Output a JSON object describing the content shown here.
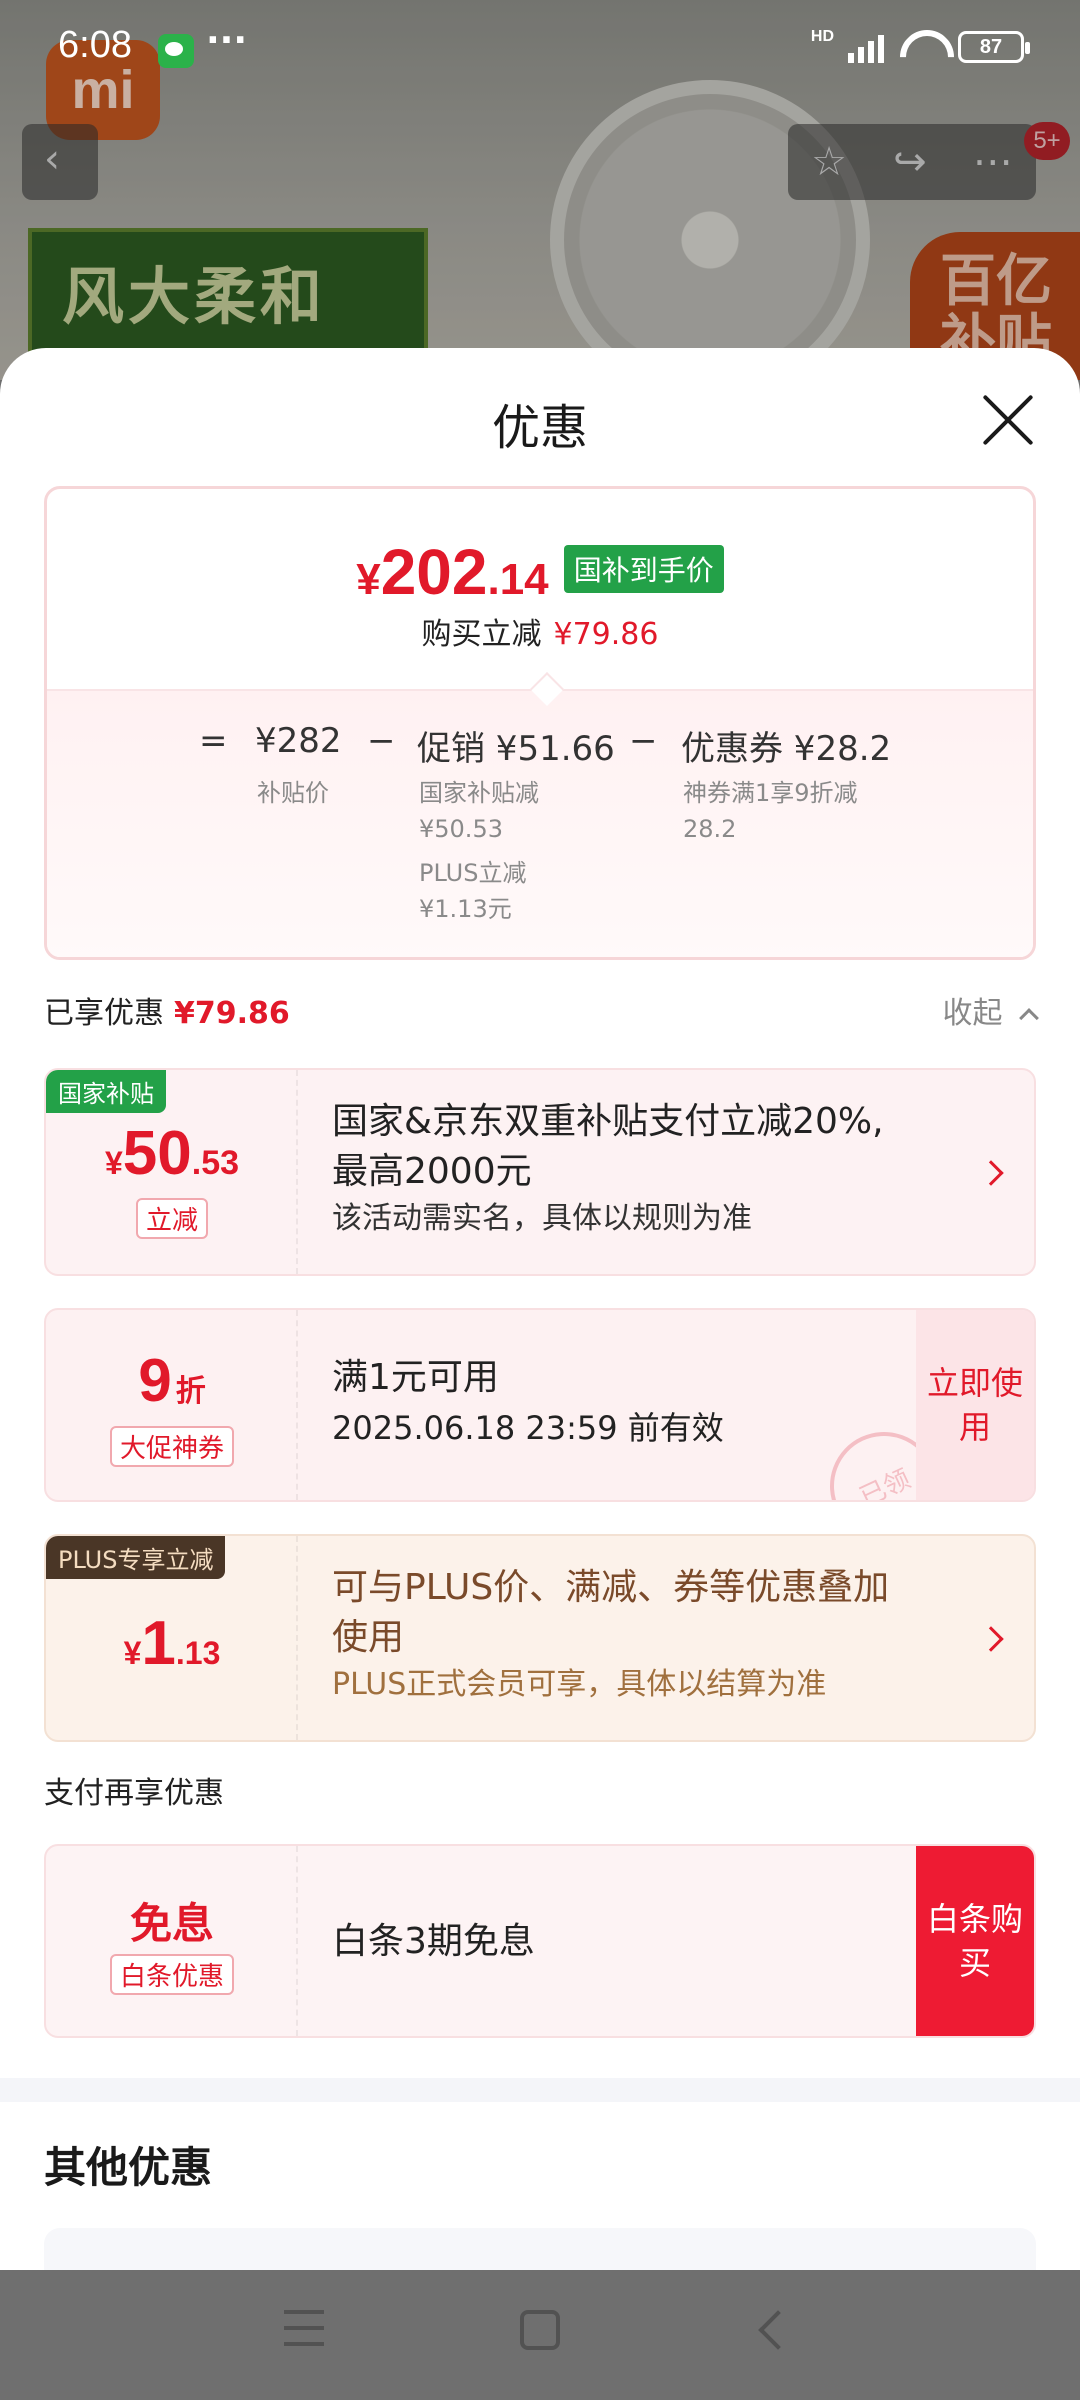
{
  "status_bar": {
    "time": "6:08",
    "more": "···",
    "network": "HD",
    "battery": "87"
  },
  "background": {
    "logo_text": "mi",
    "banner_text": "风大柔和",
    "badge_text": "百亿补贴",
    "notification_count": "5+",
    "icons": [
      "back-icon",
      "star-icon",
      "share-icon",
      "more-icon"
    ]
  },
  "sheet": {
    "title": "优惠",
    "summary": {
      "currency": "¥",
      "price_int": "202",
      "price_dec": ".14",
      "price_tag": "国补到手价",
      "reduce_label": "购买立减",
      "reduce_value": "¥79.86",
      "eq": "=",
      "base_price": "¥282",
      "base_label": "补贴价",
      "minus1": "−",
      "promo": "促销 ¥51.66",
      "promo_detail_1": "国家补贴减",
      "promo_detail_1_val": "¥50.53",
      "promo_detail_2": "PLUS立减",
      "promo_detail_2_val": "¥1.13元",
      "minus2": "−",
      "coupon": "优惠券 ¥28.2",
      "coupon_detail": "神券满1享9折减",
      "coupon_detail_val": "28.2"
    },
    "enjoyed": {
      "label": "已享优惠",
      "value": "¥79.86",
      "collapse": "收起"
    },
    "cards": [
      {
        "tag": "国家补贴",
        "cur": "¥",
        "int": "50",
        "dec": ".53",
        "sub": "立减",
        "line1": "国家&京东双重补贴支付立减20%,",
        "line2": "最高2000元",
        "line3": "该活动需实名，具体以规则为准"
      },
      {
        "int": "9",
        "unit": "折",
        "sub": "大促神券",
        "line1": "满1元可用",
        "line2": "2025.06.18 23:59 前有效",
        "button": "立即使用",
        "stamp": "已领"
      },
      {
        "tag": "PLUS专享立减",
        "cur": "¥",
        "int": "1",
        "dec": ".13",
        "line1": "可与PLUS价、满减、券等优惠叠加",
        "line2": "使用",
        "line3": "PLUS正式会员可享，具体以结算为准"
      }
    ],
    "pay_title": "支付再享优惠",
    "pay_card": {
      "main": "免息",
      "sub": "白条优惠",
      "desc": "白条3期免息",
      "button": "白条购买"
    },
    "other_title": "其他优惠"
  },
  "colors": {
    "accent_red": "#e1192a",
    "green_tag": "#23a148",
    "plus_tag": "#4a3626"
  }
}
